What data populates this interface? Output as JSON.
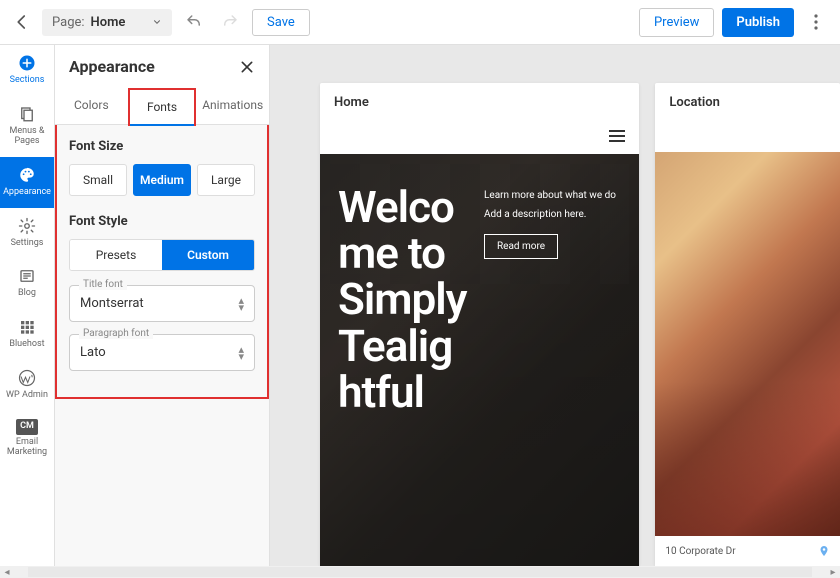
{
  "topbar": {
    "page_label": "Page:",
    "page_value": "Home",
    "save": "Save",
    "preview": "Preview",
    "publish": "Publish"
  },
  "leftnav": {
    "sections": "Sections",
    "menus": "Menus & Pages",
    "appearance": "Appearance",
    "settings": "Settings",
    "blog": "Blog",
    "bluehost": "Bluehost",
    "wpadmin": "WP Admin",
    "email": "Email Marketing",
    "cm": "CM"
  },
  "panel": {
    "title": "Appearance",
    "tabs": {
      "colors": "Colors",
      "fonts": "Fonts",
      "animations": "Animations"
    },
    "font_size_label": "Font Size",
    "sizes": {
      "small": "Small",
      "medium": "Medium",
      "large": "Large"
    },
    "font_style_label": "Font Style",
    "styles": {
      "presets": "Presets",
      "custom": "Custom"
    },
    "title_font_label": "Title font",
    "title_font_value": "Montserrat",
    "para_font_label": "Paragraph font",
    "para_font_value": "Lato"
  },
  "preview": {
    "home": {
      "title": "Home",
      "hero_title": "Welcome to Simply Tealightful",
      "subtitle": "Learn more about what we do",
      "desc": "Add a description here.",
      "readmore": "Read more"
    },
    "location": {
      "title": "Location",
      "address": "10 Corporate Dr"
    }
  }
}
